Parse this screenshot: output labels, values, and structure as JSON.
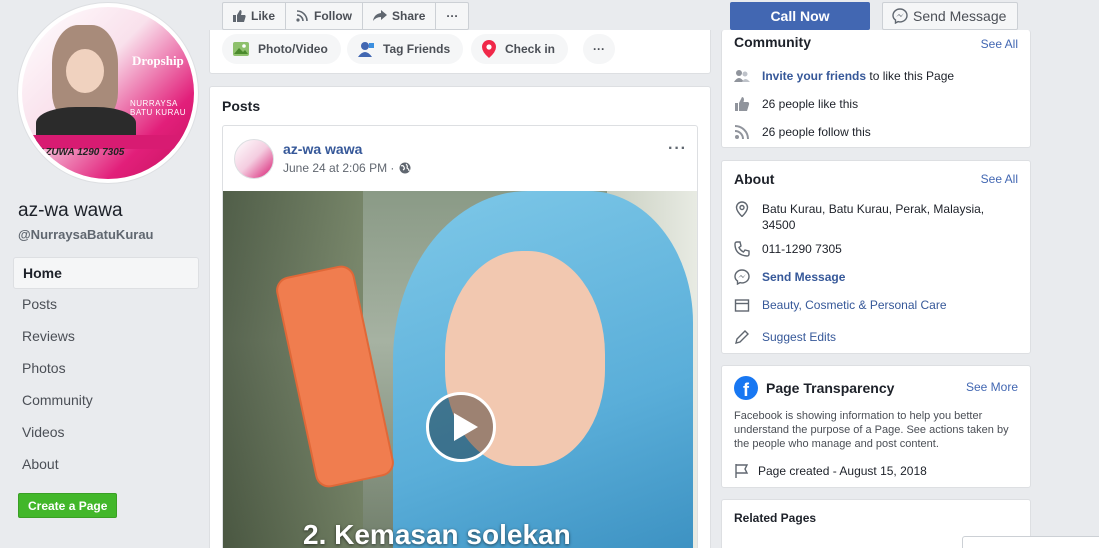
{
  "page": {
    "name": "az-wa wawa",
    "handle": "@NurraysaBatuKurau",
    "avatar": {
      "brand": "Dropship",
      "brand_sub": "NURRAYSA BATU KURAU",
      "phone_fragment": "1290 7305",
      "name_fragment": "AZUWA"
    }
  },
  "nav": {
    "items": [
      {
        "label": "Home",
        "active": true
      },
      {
        "label": "Posts"
      },
      {
        "label": "Reviews"
      },
      {
        "label": "Photos"
      },
      {
        "label": "Community"
      },
      {
        "label": "Videos"
      },
      {
        "label": "About"
      }
    ],
    "create_page": "Create a Page"
  },
  "actions": {
    "like": "Like",
    "follow": "Follow",
    "share": "Share",
    "more": "···",
    "call_now": "Call Now",
    "send_message": "Send Message"
  },
  "composer": {
    "photo_video": "Photo/Video",
    "tag_friends": "Tag Friends",
    "check_in": "Check in",
    "more": "···"
  },
  "posts": {
    "title": "Posts",
    "post": {
      "author": "az-wa wawa",
      "time": "June 24 at 2:06 PM · ",
      "menu": "···",
      "caption": "2. Kemasan solekan"
    }
  },
  "community": {
    "title": "Community",
    "see_all": "See All",
    "invite_link": "Invite your friends",
    "invite_rest": " to like this Page",
    "likes": "26 people like this",
    "follows": "26 people follow this"
  },
  "about": {
    "title": "About",
    "see_all": "See All",
    "address": "Batu Kurau, Batu Kurau, Perak, Malaysia, 34500",
    "phone": "011-1290 7305",
    "send_message": "Send Message",
    "category": "Beauty, Cosmetic & Personal Care",
    "suggest_edits": "Suggest Edits"
  },
  "transparency": {
    "title": "Page Transparency",
    "see_more": "See More",
    "text": "Facebook is showing information to help you better understand the purpose of a Page. See actions taken by the people who manage and post content.",
    "created": "Page created - August 15, 2018"
  },
  "related": {
    "title": "Related Pages"
  },
  "colors": {
    "background": "#e9ebee",
    "primary": "#4267b2",
    "link": "#365899",
    "create_green": "#42b72a",
    "brand_pink": "#d81b72"
  }
}
